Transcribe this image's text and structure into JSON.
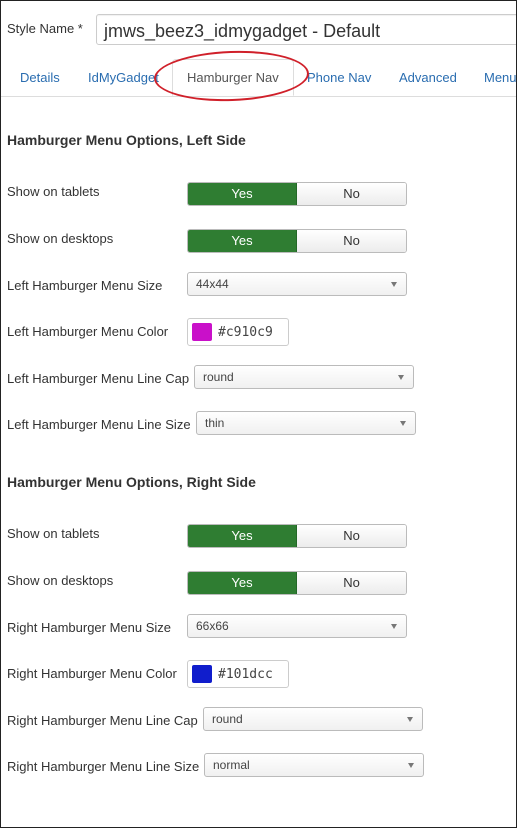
{
  "style_name": {
    "label": "Style Name *",
    "value": "jmws_beez3_idmygadget - Default"
  },
  "tabs": [
    {
      "label": "Details"
    },
    {
      "label": "IdMyGadget"
    },
    {
      "label": "Hamburger Nav",
      "active": true
    },
    {
      "label": "Phone Nav"
    },
    {
      "label": "Advanced"
    },
    {
      "label": "Menu"
    }
  ],
  "colors": {
    "yes_active": "#2f7d32",
    "tab_link": "#2a6db0",
    "callout_ring": "#d0202a"
  },
  "left_section": {
    "heading": "Hamburger Menu Options, Left Side",
    "show_on_tablets": {
      "label": "Show on tablets",
      "yes": "Yes",
      "no": "No",
      "selected": "Yes"
    },
    "show_on_desktops": {
      "label": "Show on desktops",
      "yes": "Yes",
      "no": "No",
      "selected": "Yes"
    },
    "menu_size": {
      "label": "Left Hamburger Menu Size",
      "value": "44x44"
    },
    "menu_color": {
      "label": "Left Hamburger Menu Color",
      "value": "#c910c9",
      "swatch": "#c910c9"
    },
    "line_cap": {
      "label": "Left Hamburger Menu Line Cap",
      "value": "round"
    },
    "line_size": {
      "label": "Left Hamburger Menu Line Size",
      "value": "thin"
    }
  },
  "right_section": {
    "heading": "Hamburger Menu Options, Right Side",
    "show_on_tablets": {
      "label": "Show on tablets",
      "yes": "Yes",
      "no": "No",
      "selected": "Yes"
    },
    "show_on_desktops": {
      "label": "Show on desktops",
      "yes": "Yes",
      "no": "No",
      "selected": "Yes"
    },
    "menu_size": {
      "label": "Right Hamburger Menu Size",
      "value": "66x66"
    },
    "menu_color": {
      "label": "Right Hamburger Menu Color",
      "value": "#101dcc",
      "swatch": "#101dcc"
    },
    "line_cap": {
      "label": "Right Hamburger Menu Line Cap",
      "value": "round"
    },
    "line_size": {
      "label": "Right Hamburger Menu Line Size",
      "value": "normal"
    }
  }
}
